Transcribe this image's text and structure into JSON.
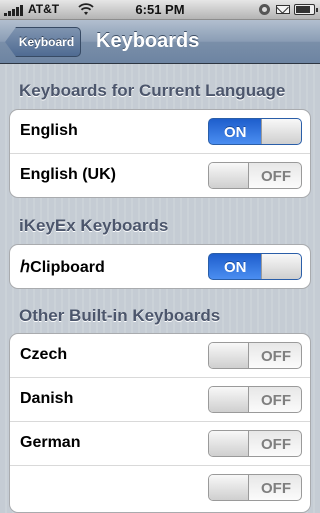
{
  "status_bar": {
    "carrier": "AT&T",
    "time": "6:51 PM",
    "signal_icon": "signal-bars-icon",
    "wifi_icon": "wifi-icon",
    "battery_level": 0.85
  },
  "nav": {
    "back_label": "Keyboard",
    "title": "Keyboards"
  },
  "sections": [
    {
      "header": "Keyboards for Current Language",
      "rows": [
        {
          "label": "English",
          "state": "ON",
          "on": true
        },
        {
          "label": "English (UK)",
          "state": "OFF",
          "on": false
        }
      ]
    },
    {
      "header": "iKeyEx Keyboards",
      "rows": [
        {
          "label": "ℎClipboard",
          "state": "ON",
          "on": true
        }
      ]
    },
    {
      "header": "Other Built-in Keyboards",
      "rows": [
        {
          "label": "Czech",
          "state": "OFF",
          "on": false
        },
        {
          "label": "Danish",
          "state": "OFF",
          "on": false
        },
        {
          "label": "German",
          "state": "OFF",
          "on": false
        },
        {
          "label": "",
          "state": "OFF",
          "on": false
        }
      ]
    }
  ]
}
